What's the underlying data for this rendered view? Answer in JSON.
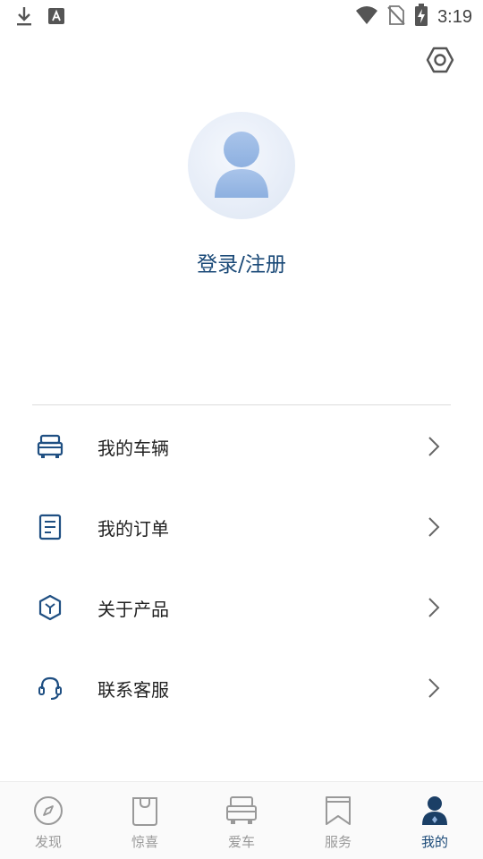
{
  "status_bar": {
    "time": "3:19",
    "icons": [
      "download-icon",
      "text-a-icon",
      "wifi-icon",
      "no-sim-icon",
      "battery-charging-icon"
    ]
  },
  "header": {
    "settings_icon": "settings-hexagon-icon"
  },
  "profile": {
    "avatar_icon": "user-avatar-icon",
    "login_label": "登录/注册"
  },
  "menu": {
    "items": [
      {
        "label": "我的车辆",
        "icon": "vehicle-icon"
      },
      {
        "label": "我的订单",
        "icon": "order-document-icon"
      },
      {
        "label": "关于产品",
        "icon": "product-cube-icon"
      },
      {
        "label": "联系客服",
        "icon": "headset-icon"
      }
    ]
  },
  "tab_bar": {
    "active": "我的",
    "tabs": [
      {
        "label": "发现",
        "icon": "compass-icon"
      },
      {
        "label": "惊喜",
        "icon": "shopping-bag-icon"
      },
      {
        "label": "爱车",
        "icon": "car-icon"
      },
      {
        "label": "服务",
        "icon": "bookmark-icon"
      },
      {
        "label": "我的",
        "icon": "person-icon"
      }
    ]
  },
  "colors": {
    "accent": "#1b4a78",
    "inactive": "#999999",
    "icon_stroke": "#1f4f82"
  }
}
